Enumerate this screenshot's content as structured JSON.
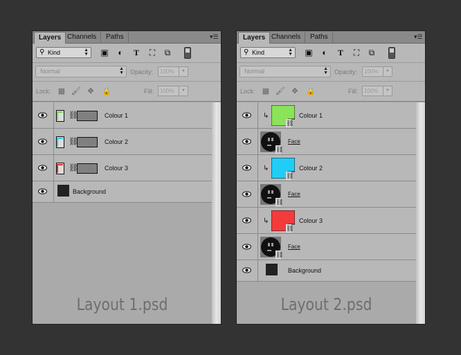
{
  "panels": [
    {
      "tabs": [
        "Layers",
        "Channels",
        "Paths"
      ],
      "kind": "Kind",
      "blend_mode": "Normal",
      "opacity_label": "Opacity:",
      "opacity_value": "100%",
      "lock_label": "Lock:",
      "fill_label": "Fill:",
      "fill_value": "100%",
      "caption": "Layout 1.psd",
      "layers": [
        {
          "name": "Colour 1",
          "type": "adjustment",
          "color": "#7dd860"
        },
        {
          "name": "Colour 2",
          "type": "adjustment",
          "color": "#3cc6e8"
        },
        {
          "name": "Colour 3",
          "type": "adjustment",
          "color": "#e03030"
        },
        {
          "name": "Background",
          "type": "background"
        }
      ]
    },
    {
      "tabs": [
        "Layers",
        "Channels",
        "Paths"
      ],
      "kind": "Kind",
      "blend_mode": "Normal",
      "opacity_label": "Opacity:",
      "opacity_value": "100%",
      "lock_label": "Lock:",
      "fill_label": "Fill:",
      "fill_value": "100%",
      "caption": "Layout 2.psd",
      "layers": [
        {
          "name": "Colour 1",
          "type": "clipped-color",
          "color": "#8be35a"
        },
        {
          "name": "Face",
          "type": "smart"
        },
        {
          "name": "Colour 2",
          "type": "clipped-color",
          "color": "#21cdf6"
        },
        {
          "name": "Face",
          "type": "smart"
        },
        {
          "name": "Colour 3",
          "type": "clipped-color",
          "color": "#f43b3b"
        },
        {
          "name": "Face",
          "type": "smart"
        },
        {
          "name": "Background",
          "type": "background"
        }
      ]
    }
  ]
}
